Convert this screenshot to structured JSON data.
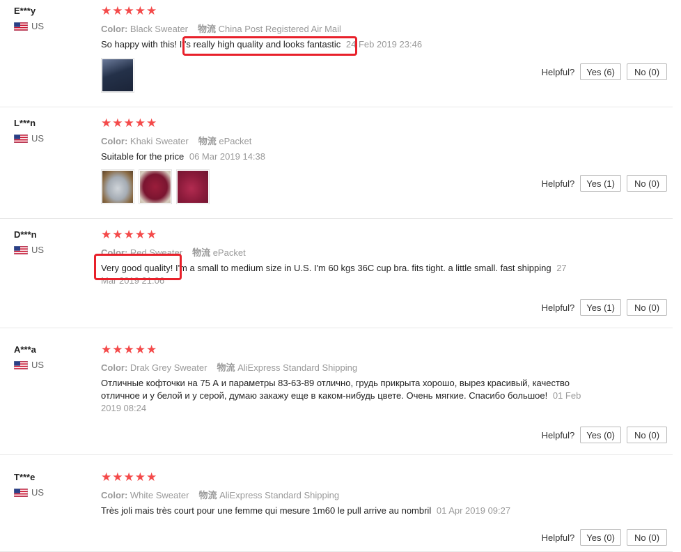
{
  "helpful_label": "Helpful?",
  "shipping_label": "物流",
  "color_label": "Color:",
  "reviews": [
    {
      "user": "E***y",
      "country": "US",
      "stars": "★★★★★",
      "color": "Black Sweater",
      "shipping": "China Post Registered Air Mail",
      "text": "So happy with this! It's really high quality and looks fantastic",
      "date": "24 Feb 2019 23:46",
      "yes": "Yes (6)",
      "no": "No (0)"
    },
    {
      "user": "L***n",
      "country": "US",
      "stars": "★★★★★",
      "color": "Khaki Sweater",
      "shipping": "ePacket",
      "text": "Suitable for the price",
      "date": "06 Mar 2019 14:38",
      "yes": "Yes (1)",
      "no": "No (0)"
    },
    {
      "user": "D***n",
      "country": "US",
      "stars": "★★★★★",
      "color": "Red Sweater",
      "shipping": "ePacket",
      "text": "Very good quality! I'm a small to medium size in U.S. I'm 60 kgs 36C cup bra. fits tight. a little small. fast shipping",
      "date": "27 Mar 2019 21:06",
      "yes": "Yes (1)",
      "no": "No (0)"
    },
    {
      "user": "A***a",
      "country": "US",
      "stars": "★★★★★",
      "color": "Drak Grey Sweater",
      "shipping": "AliExpress Standard Shipping",
      "text": "Отличные кофточки на 75 А и параметры 83-63-89 отлично, грудь прикрыта хорошо, вырез красивый, качество отличное и у белой и у серой, думаю закажу еще в каком-нибудь цвете. Очень мягкие. Спасибо большое!",
      "date": "01 Feb 2019 08:24",
      "yes": "Yes (0)",
      "no": "No (0)"
    },
    {
      "user": "T***e",
      "country": "US",
      "stars": "★★★★★",
      "color": "White Sweater",
      "shipping": "AliExpress Standard Shipping",
      "text": "Très joli mais très court pour une femme qui mesure 1m60 le pull arrive au nombril",
      "date": "01 Apr 2019 09:27",
      "yes": "Yes (0)",
      "no": "No (0)"
    }
  ]
}
